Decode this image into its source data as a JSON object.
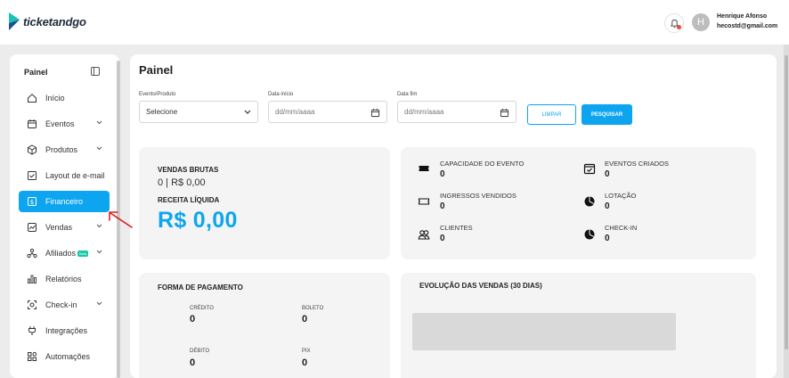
{
  "app": {
    "logo_text": "ticketandgo"
  },
  "header": {
    "user": {
      "avatar_initial": "H",
      "name": "Henrique Afonso",
      "email": "hecostd@gmail.com"
    }
  },
  "sidebar": {
    "title": "Painel",
    "items": [
      {
        "label": "Início",
        "icon": "home-icon",
        "has_submenu": false,
        "active": false
      },
      {
        "label": "Eventos",
        "icon": "calendar-icon",
        "has_submenu": true,
        "active": false
      },
      {
        "label": "Produtos",
        "icon": "box-icon",
        "has_submenu": true,
        "active": false
      },
      {
        "label": "Layout de e-mail",
        "icon": "email-layout-icon",
        "has_submenu": false,
        "active": false
      },
      {
        "label": "Financeiro",
        "icon": "dollar-icon",
        "has_submenu": false,
        "active": true
      },
      {
        "label": "Vendas",
        "icon": "chart-icon",
        "has_submenu": true,
        "active": false
      },
      {
        "label": "Afiliados",
        "icon": "affiliates-icon",
        "has_submenu": true,
        "active": false,
        "badge": "Beta"
      },
      {
        "label": "Relatórios",
        "icon": "reports-icon",
        "has_submenu": false,
        "active": false
      },
      {
        "label": "Check-in",
        "icon": "checkin-icon",
        "has_submenu": true,
        "active": false
      },
      {
        "label": "Integrações",
        "icon": "plug-icon",
        "has_submenu": false,
        "active": false
      },
      {
        "label": "Automações",
        "icon": "automation-icon",
        "has_submenu": false,
        "active": false
      }
    ]
  },
  "main": {
    "title": "Painel",
    "filters": {
      "event_label": "Evento/Produto",
      "event_value": "Selecione",
      "start_label": "Data início",
      "start_placeholder": "dd/mm/aaaa",
      "end_label": "Data fim",
      "end_placeholder": "dd/mm/aaaa",
      "clear_label": "LIMPAR",
      "search_label": "PESQUISAR"
    },
    "sales": {
      "gross_label": "VENDAS BRUTAS",
      "gross_value": "0 | R$ 0,00",
      "net_label": "RECEITA LÍQUIDA",
      "net_value": "R$ 0,00"
    },
    "stats": [
      {
        "label": "CAPACIDADE DO EVENTO",
        "value": "0",
        "icon": "ticket-icon"
      },
      {
        "label": "EVENTOS CRIADOS",
        "value": "0",
        "icon": "calendar-check-icon"
      },
      {
        "label": "INGRESSOS VENDIDOS",
        "value": "0",
        "icon": "ticket-outline-icon"
      },
      {
        "label": "LOTAÇÃO",
        "value": "0",
        "icon": "pie-chart-icon"
      },
      {
        "label": "CLIENTES",
        "value": "0",
        "icon": "users-icon"
      },
      {
        "label": "CHECK-IN",
        "value": "0",
        "icon": "pie-chart-icon"
      }
    ],
    "payment": {
      "title": "FORMA DE PAGAMENTO",
      "methods": [
        {
          "label": "CRÉDITO",
          "value": "0"
        },
        {
          "label": "BOLETO",
          "value": "0"
        },
        {
          "label": "DÉBITO",
          "value": "0"
        },
        {
          "label": "PIX",
          "value": "0"
        }
      ]
    },
    "evolution": {
      "title": "EVOLUÇÃO DAS VENDAS (30 DIAS)"
    }
  },
  "colors": {
    "accent": "#0ea5f0",
    "beta_badge": "#19c6a8",
    "notification_dot": "#e74c3c",
    "annotation_arrow": "#e02020"
  }
}
